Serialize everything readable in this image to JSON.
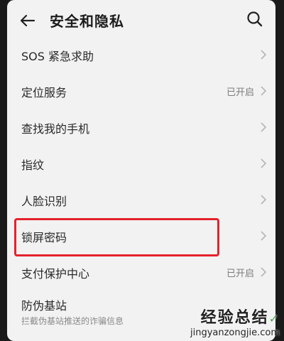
{
  "header": {
    "title": "安全和隐私"
  },
  "items": [
    {
      "label": "SOS 紧急求助",
      "value": ""
    },
    {
      "label": "定位服务",
      "value": "已开启"
    },
    {
      "label": "查找我的手机",
      "value": ""
    },
    {
      "label": "指纹",
      "value": ""
    },
    {
      "label": "人脸识别",
      "value": ""
    },
    {
      "label": "锁屏密码",
      "value": ""
    },
    {
      "label": "支付保护中心",
      "value": "已开启"
    },
    {
      "label": "防伪基站",
      "value": "",
      "sub": "拦截伪基站推送的诈骗信息"
    }
  ],
  "watermark": {
    "title": "经验总结",
    "url": "jingyanzongjie.com"
  },
  "colors": {
    "highlight": "#e4222c",
    "background": "#f2f2f2"
  }
}
